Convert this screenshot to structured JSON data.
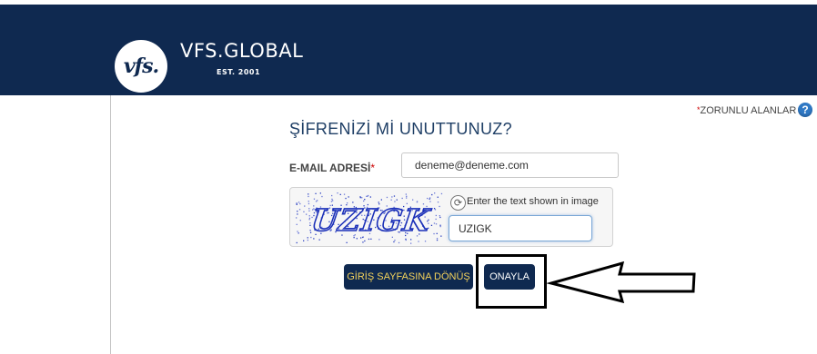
{
  "header": {
    "logo_text": "vfs.",
    "brand_name": "VFS.GLOBAL",
    "brand_tagline": "EST. 2001",
    "background_color": "#0f2950"
  },
  "required_note": {
    "star": "*",
    "text": "ZORUNLU ALANLAR"
  },
  "help_icon": {
    "symbol": "?",
    "icon": "question-circle-icon"
  },
  "page_title": "ŞİFRENİZİ Mİ UNUTTUNUZ?",
  "email": {
    "label": "E-MAIL ADRESİ",
    "required_star": "*",
    "value": "deneme@deneme.com"
  },
  "captcha": {
    "image_text": "UZIGK",
    "hint": "Enter the text shown in image",
    "input_value": "UZIGK",
    "refresh_icon": "refresh-icon"
  },
  "buttons": {
    "back_label": "GİRİŞ SAYFASINA DÖNÜŞ",
    "confirm_label": "ONAYLA"
  },
  "colors": {
    "accent": "#0f2950",
    "back_text": "#f4d25a",
    "required": "#cc0000"
  }
}
